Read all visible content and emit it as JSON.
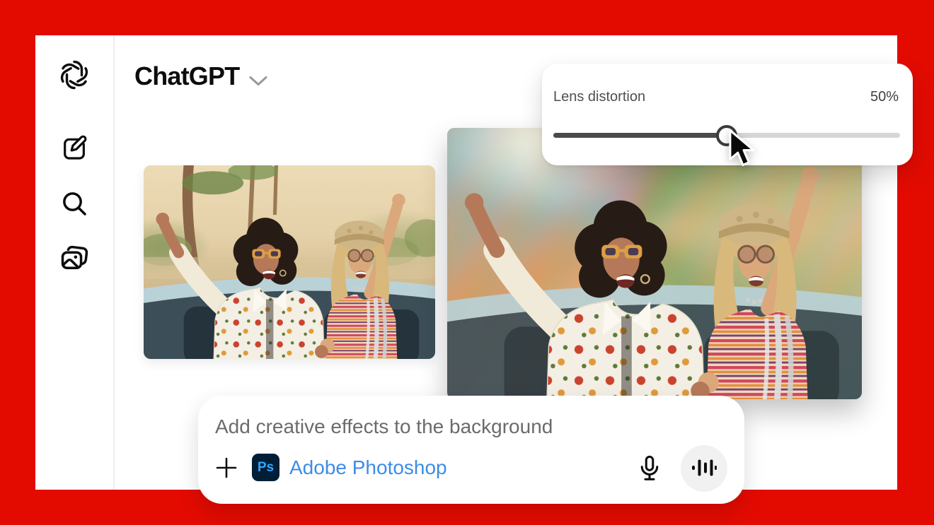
{
  "frame": {
    "color": "#e30b00"
  },
  "header": {
    "title": "ChatGPT"
  },
  "sidebar": {
    "icons": [
      "openai-logo",
      "new-chat",
      "search",
      "library"
    ]
  },
  "lens_panel": {
    "label": "Lens distortion",
    "value": "50%",
    "percent": 50
  },
  "composer": {
    "prompt": "Add creative effects to the background",
    "app_badge": "Ps",
    "app_name": "Adobe Photoshop"
  },
  "colors": {
    "frame_red": "#e30b00",
    "link_blue": "#3d8ce8",
    "ps_badge_bg": "#001e36",
    "ps_badge_text": "#31a8ff",
    "slider_fill": "#4a4a4a",
    "slider_track": "#d6d6d6"
  }
}
